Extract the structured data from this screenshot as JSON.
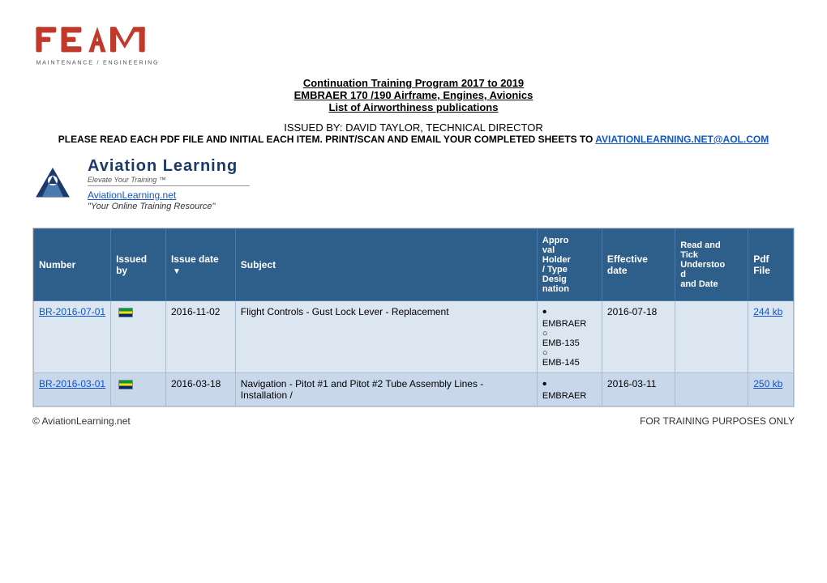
{
  "header": {
    "title_line1": "Continuation Training Program 2017 to 2019",
    "title_line2": "EMBRAER 170 /190 Airframe, Engines, Avionics",
    "title_line3": "List of Airworthiness publications",
    "issued_by_label": "ISSUED BY: DAVID TAYLOR, TECHNICAL DIRECTOR",
    "notice_text": "PLEASE READ EACH PDF FILE AND INITIAL EACH ITEM.  PRINT/SCAN AND EMAIL YOUR COMPLETED SHEETS TO",
    "email": "aviationlearning.net@aol.com"
  },
  "aviation_learning": {
    "brand": "Aviation Learning",
    "tagline": "Elevate Your Training ™",
    "url": "AviationLearning.net",
    "quote": "\"Your Online Training Resource\""
  },
  "table": {
    "columns": [
      {
        "id": "number",
        "label": "Number"
      },
      {
        "id": "issued_by",
        "label": "Issued by"
      },
      {
        "id": "issue_date",
        "label": "Issue date"
      },
      {
        "id": "subject",
        "label": "Subject"
      },
      {
        "id": "approval",
        "label": "Appro val Holder / Type Desig nation"
      },
      {
        "id": "effective_date",
        "label": "Effective date"
      },
      {
        "id": "read_tick",
        "label": "Read and Tick Understood and Date"
      },
      {
        "id": "pdf_file",
        "label": "Pdf File"
      }
    ],
    "rows": [
      {
        "number": "BR-2016-07-01",
        "issued_by": "BR_FLAG",
        "issue_date": "2016-11-02",
        "subject": "Flight Controls - Gust Lock Lever - Replacement",
        "approval": "• \nEMBRAER\n○\nEMB-135\n○\nEMB-145",
        "effective_date": "2016-07-18",
        "read_tick": "",
        "pdf_file": "244 kb"
      },
      {
        "number": "BR-2016-03-01",
        "issued_by": "BR_FLAG",
        "issue_date": "2016-03-18",
        "subject": "Navigation - Pitot #1 and Pitot #2 Tube Assembly Lines - Installation /",
        "approval": "• \nEMBRAER",
        "effective_date": "2016-03-11",
        "read_tick": "",
        "pdf_file": "250 kb"
      }
    ]
  },
  "footer": {
    "copyright": "© AviationLearning.net",
    "training_notice": "FOR TRAINING PURPOSES ONLY"
  }
}
